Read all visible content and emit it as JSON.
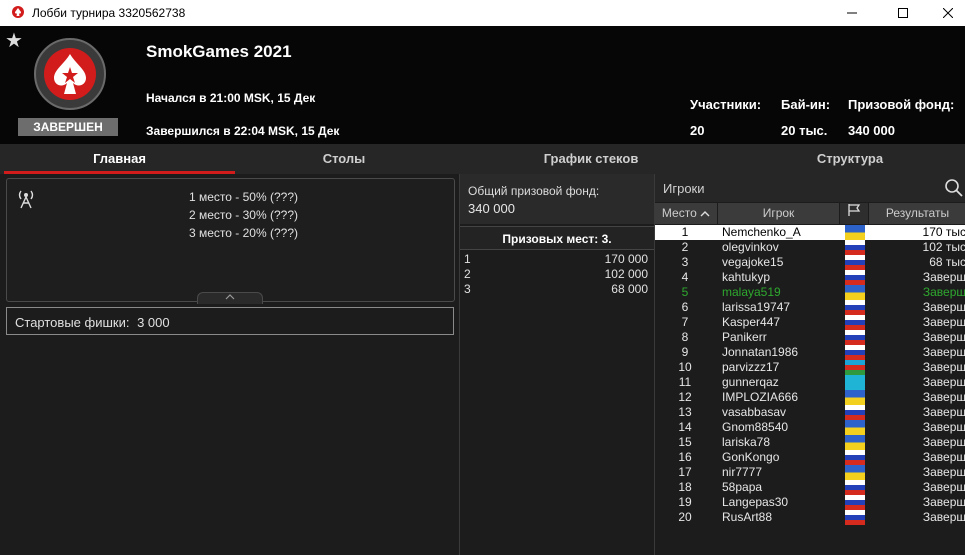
{
  "window": {
    "title": "Лобби турнира 3320562738"
  },
  "header": {
    "tournament_name": "SmokGames 2021",
    "started": "Начался в 21:00 MSK, 15 Дек",
    "ended": "Завершился в 22:04 MSK, 15 Дек",
    "status": "ЗАВЕРШЕН",
    "stats": [
      {
        "label": "Участники:",
        "value": "20"
      },
      {
        "label": "Бай-ин:",
        "value": "20 тыс."
      },
      {
        "label": "Призовой фонд:",
        "value": "340 000"
      }
    ],
    "brand_color": "#d21c1c"
  },
  "tabs": [
    {
      "label": "Главная",
      "active": true
    },
    {
      "label": "Столы",
      "active": false
    },
    {
      "label": "График стеков",
      "active": false
    },
    {
      "label": "Структура",
      "active": false
    }
  ],
  "payouts": {
    "lines": [
      "1 место - 50% (???)",
      "2 место - 30% (???)",
      "3 место - 20% (???)"
    ]
  },
  "starting_chips": {
    "label": "Стартовые фишки:",
    "value": "3 000"
  },
  "prize": {
    "label": "Общий призовой фонд:",
    "amount": "340 000",
    "places_title": "Призовых мест: 3.",
    "places": [
      {
        "place": "1",
        "amount": "170 000"
      },
      {
        "place": "2",
        "amount": "102 000"
      },
      {
        "place": "3",
        "amount": "68 000"
      }
    ]
  },
  "players": {
    "search_label": "Игроки",
    "columns": {
      "place": "Место",
      "player": "Игрок",
      "results": "Результаты"
    },
    "rows": [
      {
        "place": "1",
        "name": "Nemchenko_A",
        "flag": "ua",
        "result": "170 тыс",
        "highlight": true
      },
      {
        "place": "2",
        "name": "olegvinkov",
        "flag": "ru",
        "result": "102 тыс"
      },
      {
        "place": "3",
        "name": "vegajoke15",
        "flag": "ru",
        "result": "68 тыс"
      },
      {
        "place": "4",
        "name": "kahtukyp",
        "flag": "ru",
        "result": "Заверш"
      },
      {
        "place": "5",
        "name": "malaya519",
        "flag": "ua",
        "result": "Заверш",
        "green": true
      },
      {
        "place": "6",
        "name": "larissa19747",
        "flag": "ru",
        "result": "Заверш"
      },
      {
        "place": "7",
        "name": "Kasper447",
        "flag": "ru",
        "result": "Заверш"
      },
      {
        "place": "8",
        "name": "Panikerr",
        "flag": "ru",
        "result": "Заверш"
      },
      {
        "place": "9",
        "name": "Jonnatan1986",
        "flag": "ru",
        "result": "Заверш"
      },
      {
        "place": "10",
        "name": "parvizzz17",
        "flag": "az",
        "result": "Заверш"
      },
      {
        "place": "11",
        "name": "gunnerqaz",
        "flag": "kz",
        "result": "Заверш"
      },
      {
        "place": "12",
        "name": "IMPLOZIA666",
        "flag": "ua",
        "result": "Заверш"
      },
      {
        "place": "13",
        "name": "vasabbasav",
        "flag": "ru",
        "result": "Заверш"
      },
      {
        "place": "14",
        "name": "Gnom88540",
        "flag": "ua",
        "result": "Заверш"
      },
      {
        "place": "15",
        "name": "lariska78",
        "flag": "ua",
        "result": "Заверш"
      },
      {
        "place": "16",
        "name": "GonKongo",
        "flag": "ru",
        "result": "Заверш"
      },
      {
        "place": "17",
        "name": "nir7777",
        "flag": "ua",
        "result": "Заверш"
      },
      {
        "place": "18",
        "name": "58papa",
        "flag": "ru",
        "result": "Заверш"
      },
      {
        "place": "19",
        "name": "Langepas30",
        "flag": "ru",
        "result": "Заверш"
      },
      {
        "place": "20",
        "name": "RusArt88",
        "flag": "ru",
        "result": "Заверш"
      }
    ]
  }
}
